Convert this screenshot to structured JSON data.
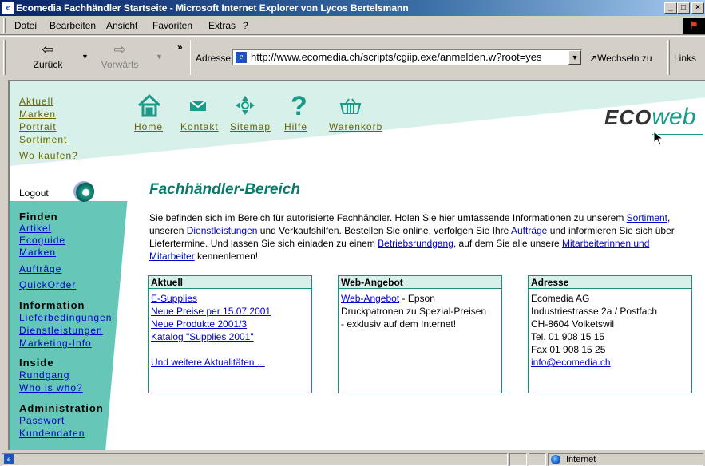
{
  "window": {
    "title": "Ecomedia Fachhändler Startseite - Microsoft Internet Explorer von Lycos Bertelsmann",
    "controls": [
      "_",
      "□",
      "×"
    ]
  },
  "menu": [
    "Datei",
    "Bearbeiten",
    "Ansicht",
    "Favoriten",
    "Extras",
    "?"
  ],
  "toolbar": {
    "back_label": "Zurück",
    "forward_label": "Vorwärts",
    "chevron": "»",
    "address_label": "Adresse",
    "url": "http://www.ecomedia.ch/scripts/cgiip.exe/anmelden.w?root=yes",
    "go_label": "Wechseln zu",
    "links_label": "Links"
  },
  "nav": {
    "left_links": [
      "Aktuell",
      "Marken",
      "Portrait",
      "Sortiment",
      "Wo kaufen?"
    ],
    "top_items": [
      {
        "label": "Home",
        "icon": "home-icon"
      },
      {
        "label": "Kontakt",
        "icon": "envelope-icon"
      },
      {
        "label": "Sitemap",
        "icon": "sitemap-icon"
      },
      {
        "label": "Hilfe",
        "icon": "help-icon"
      },
      {
        "label": "Warenkorb",
        "icon": "basket-icon"
      }
    ],
    "logo": {
      "part1": "ECO",
      "part2": "web"
    }
  },
  "sidebar": {
    "logout": "Logout",
    "sections": [
      {
        "title": "Finden",
        "items": [
          "Artikel",
          "Ecoguide",
          "Marken",
          "Aufträge",
          "QuickOrder"
        ]
      },
      {
        "title": "Information",
        "items": [
          "Lieferbedingungen",
          "Dienstleistungen",
          "Marketing-Info"
        ]
      },
      {
        "title": "Inside",
        "items": [
          "Rundgang",
          "Who is who?"
        ]
      },
      {
        "title": "Administration",
        "items": [
          "Passwort",
          "Kundendaten"
        ]
      }
    ]
  },
  "main": {
    "heading": "Fachhändler-Bereich",
    "intro": {
      "t1": "Sie befinden sich im Bereich für autorisierte Fachhändler. Holen Sie hier umfassende Informationen zu unserem ",
      "l1": "Sortiment",
      "t2": ", unseren ",
      "l2": "Dienstleistungen",
      "t3": " und Verkaufshilfen. Bestellen Sie online, verfolgen Sie Ihre ",
      "l3": "Aufträge",
      "t4": " und informieren Sie sich über Liefertermine. Und lassen Sie sich einladen zu einem ",
      "l4": "Betriebsrundgang",
      "t5": ", auf dem Sie alle unsere ",
      "l5": "Mitarbeiterinnen und Mitarbeiter",
      "t6": " kennenlernen!"
    },
    "boxes": {
      "aktuell": {
        "title": "Aktuell",
        "links": [
          "E-Supplies",
          "Neue Preise per 15.07.2001",
          "Neue Produkte 2001/3",
          "Katalog \"Supplies 2001\""
        ],
        "more": "Und weitere Aktualitäten ..."
      },
      "web": {
        "title": "Web-Angebot",
        "link": "Web-Angebot",
        "text1": " - Epson",
        "text2": "Druckpatronen zu Spezial-Preisen",
        "text3": "- exklusiv auf dem Internet!"
      },
      "adresse": {
        "title": "Adresse",
        "lines": [
          "Ecomedia AG",
          "Industriestrasse 2a / Postfach",
          "CH-8604 Volketswil",
          "Tel. 01 908 15 15",
          "Fax 01 908 15 25"
        ],
        "email": "info@ecomedia.ch"
      }
    }
  },
  "status": {
    "zone": "Internet"
  },
  "colors": {
    "teal_bg": "#d8f0ea",
    "teal_side": "#66c6b7",
    "heading_teal": "#0a7a6a",
    "nav_olive": "#666600"
  }
}
